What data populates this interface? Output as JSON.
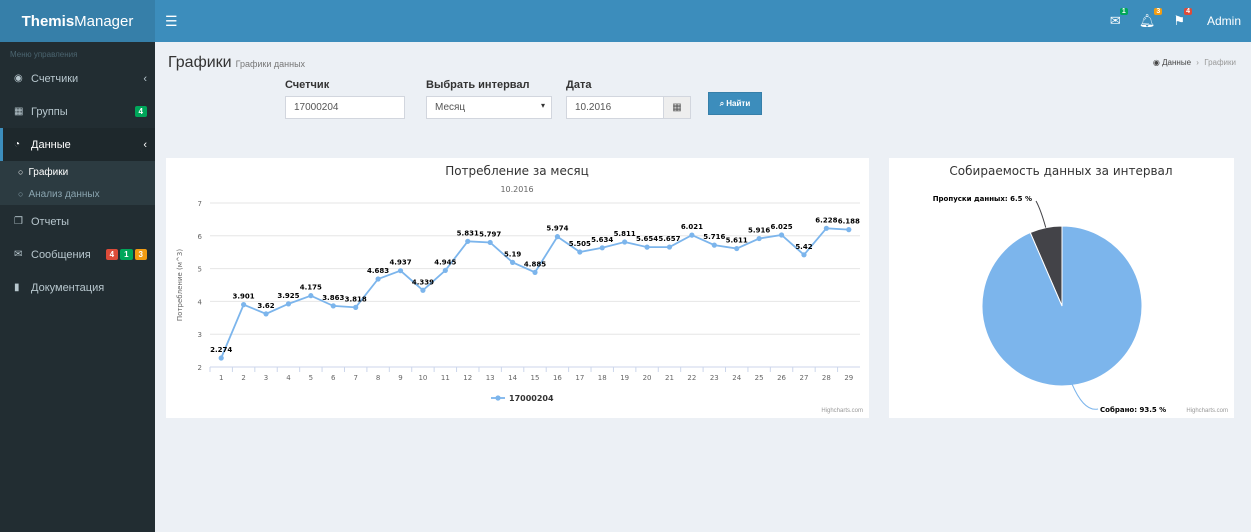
{
  "app": {
    "logo_bold": "Themis",
    "logo_rest": "Manager"
  },
  "navbar": {
    "user": "Admin",
    "badges": [
      {
        "icon": "mail-icon",
        "count": "1",
        "color": "#00a65a"
      },
      {
        "icon": "bell-icon",
        "count": "3",
        "color": "#f39c12"
      },
      {
        "icon": "flag-icon",
        "count": "4",
        "color": "#dd4b39"
      }
    ]
  },
  "sidebar": {
    "header": "Меню управления",
    "items": [
      {
        "label": "Счетчики",
        "icon": "dashboard-icon"
      },
      {
        "label": "Группы",
        "icon": "grid-icon",
        "badge": "4"
      },
      {
        "label": "Данные",
        "icon": "pie-chart-icon"
      },
      {
        "label": "Отчеты",
        "icon": "report-icon"
      },
      {
        "label": "Сообщения",
        "icon": "envelope-icon",
        "badges": [
          "4",
          "1",
          "3"
        ]
      },
      {
        "label": "Документация",
        "icon": "book-icon"
      }
    ],
    "subitems": [
      {
        "label": "Графики"
      },
      {
        "label": "Анализ данных"
      }
    ]
  },
  "page": {
    "title": "Графики",
    "subtitle": "Графики данных"
  },
  "breadcrumb": {
    "root": "Данные",
    "current": "Графики"
  },
  "filters": {
    "meter_label": "Счетчик",
    "meter_value": "17000204",
    "interval_label": "Выбрать интервал",
    "interval_value": "Месяц",
    "date_label": "Дата",
    "date_value": "10.2016",
    "find_button": "Найти"
  },
  "line_panel": {
    "title": "Потребление за месяц",
    "subtitle": "10.2016",
    "ylabel": "Потребление (м^3)",
    "credits": "Highcharts.com"
  },
  "pie_panel": {
    "title": "Собираемость данных за интервал",
    "credits": "Highcharts.com"
  },
  "chart_data": [
    {
      "type": "line",
      "title": "Потребление за месяц",
      "subtitle": "10.2016",
      "ylabel": "Потребление (м^3)",
      "ylim": [
        2,
        7
      ],
      "yticks": [
        2,
        3,
        4,
        5,
        6,
        7
      ],
      "x": [
        1,
        2,
        3,
        4,
        5,
        6,
        7,
        8,
        9,
        10,
        11,
        12,
        13,
        14,
        15,
        16,
        17,
        18,
        19,
        20,
        21,
        22,
        23,
        24,
        25,
        26,
        27,
        28,
        29
      ],
      "series": [
        {
          "name": "17000204",
          "color": "#7cb5ec",
          "values": [
            2.274,
            3.901,
            3.62,
            3.925,
            4.175,
            3.863,
            3.818,
            4.683,
            4.937,
            4.339,
            4.945,
            5.831,
            5.797,
            5.19,
            4.885,
            5.974,
            5.505,
            5.634,
            5.811,
            5.654,
            5.657,
            6.021,
            5.716,
            5.611,
            5.916,
            6.025,
            5.42,
            6.228,
            6.188
          ]
        }
      ],
      "grid": true,
      "legend": "bottom"
    },
    {
      "type": "pie",
      "title": "Собираемость данных за интервал",
      "slices": [
        {
          "label": "Пропуски данных",
          "value": 6.5,
          "text": "Пропуски данных: 6.5 %",
          "color": "#434348"
        },
        {
          "label": "Собрано",
          "value": 93.5,
          "text": "Собрано: 93.5 %",
          "color": "#7cb5ec"
        }
      ]
    }
  ]
}
